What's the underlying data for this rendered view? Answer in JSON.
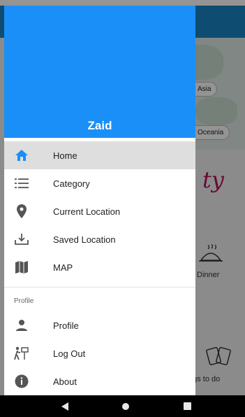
{
  "background_app": {
    "pills": [
      "Asia",
      "Oceania"
    ],
    "cursive_text": "ty",
    "cards": [
      "Dinner",
      "ngs to do"
    ]
  },
  "drawer": {
    "user_name": "Zaid",
    "items": [
      {
        "label": "Home",
        "icon": "home-icon"
      },
      {
        "label": "Category",
        "icon": "list-icon"
      },
      {
        "label": "Current Location",
        "icon": "location-pin-icon"
      },
      {
        "label": "Saved Location",
        "icon": "download-icon"
      },
      {
        "label": "MAP",
        "icon": "map-icon"
      }
    ],
    "section_title": "Profile",
    "profile_items": [
      {
        "label": "Profile",
        "icon": "person-icon"
      },
      {
        "label": "Log Out",
        "icon": "logout-icon"
      },
      {
        "label": "About",
        "icon": "info-icon"
      }
    ]
  },
  "colors": {
    "header": "#1a8ff7",
    "active_icon": "#1a8ff7",
    "active_bg": "#dedede",
    "accent_text": "#b3135a",
    "app_bar": "#1a83c4"
  },
  "navbar": {
    "buttons": [
      "back-icon",
      "home-button-icon",
      "recents-icon"
    ]
  }
}
